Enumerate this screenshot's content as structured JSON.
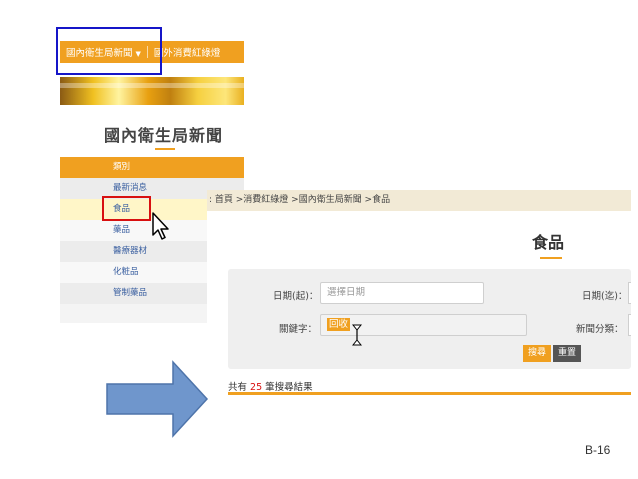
{
  "left": {
    "topnav": {
      "item1": "國內衛生局新聞",
      "caret": "▼",
      "item2": "國外消費紅綠燈"
    },
    "page_title": "國內衛生局新聞",
    "menu": [
      {
        "label": "類別",
        "style": "head"
      },
      {
        "label": "最新消息",
        "style": "alt"
      },
      {
        "label": "食品",
        "style": "sel"
      },
      {
        "label": "藥品",
        "style": "plain"
      },
      {
        "label": "醫療器材",
        "style": "alt"
      },
      {
        "label": "化粧品",
        "style": "plain"
      },
      {
        "label": "管制藥品",
        "style": "alt"
      }
    ]
  },
  "right": {
    "breadcrumb": ": 首頁 >消費紅綠燈 >國內衛生局新聞 >食品",
    "page_title": "食品",
    "date_from_label": "日期(起)：",
    "date_from_placeholder": "選擇日期",
    "date_to_label": "日期(迄)：",
    "keyword_label": "關鍵字：",
    "keyword_value": "回收",
    "category_label": "新聞分類：",
    "search_button": "搜尋",
    "reset_button": "重置",
    "result_prefix": "共有",
    "result_count": "25",
    "result_suffix": "筆搜尋結果"
  },
  "slide_number": "B-16",
  "colors": {
    "accent": "#f0a020",
    "blue_box": "#1515c8",
    "red_box": "#d81010",
    "arrow": "#6f96cc"
  }
}
